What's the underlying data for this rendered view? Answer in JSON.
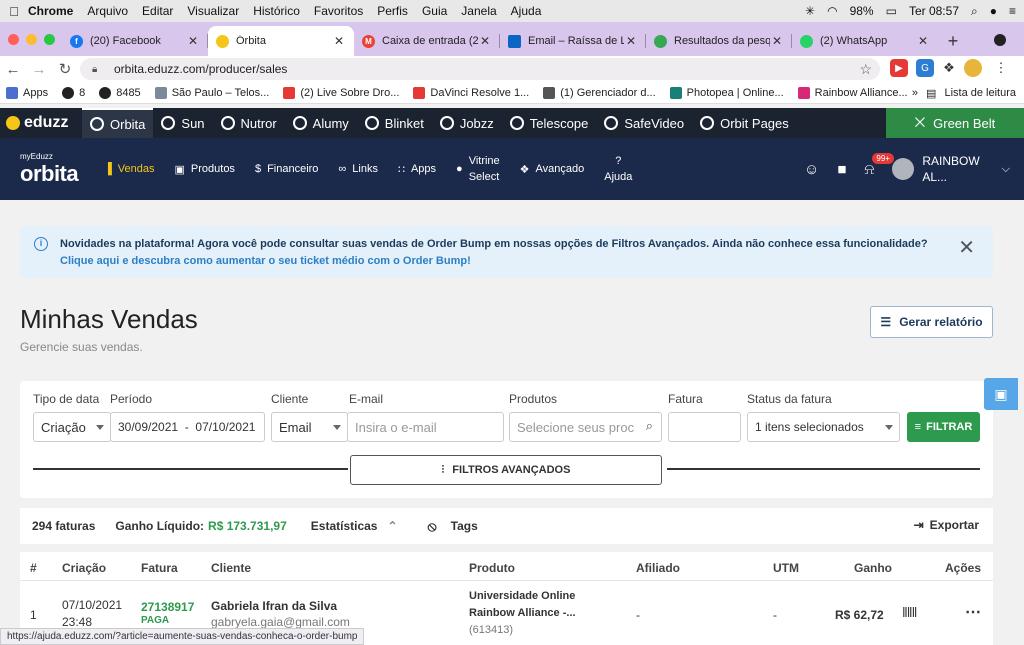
{
  "mac_menubar": {
    "app": "Chrome",
    "items": [
      "Arquivo",
      "Editar",
      "Visualizar",
      "Histórico",
      "Favoritos",
      "Perfis",
      "Guia",
      "Janela",
      "Ajuda"
    ],
    "battery": "98%",
    "clock": "Ter 08:57"
  },
  "tabs": [
    {
      "title": "(20) Facebook",
      "color": "#1877f2"
    },
    {
      "title": "Órbita",
      "color": "#f5c518"
    },
    {
      "title": "Caixa de entrada (2",
      "color": "#ea4335"
    },
    {
      "title": "Email – Raíssa de La",
      "color": "#0a66c2"
    },
    {
      "title": "Resultados da pesq",
      "color": "#34a853"
    },
    {
      "title": "(2) WhatsApp",
      "color": "#25d366"
    }
  ],
  "address": {
    "url": "orbita.eduzz.com/producer/sales"
  },
  "bookmarks": {
    "items": [
      "Apps",
      "8",
      "8485",
      "São Paulo – Telos...",
      "(2) Live Sobre Dro...",
      "DaVinci Resolve 1...",
      "(1) Gerenciador d...",
      "Photopea | Online...",
      "Rainbow Alliance..."
    ],
    "more": "»",
    "reading_list": "Lista de leitura"
  },
  "eduzz_bar": {
    "logo": "eduzz",
    "items": [
      "Orbita",
      "Sun",
      "Nutror",
      "Alumy",
      "Blinket",
      "Jobzz",
      "Telescope",
      "SafeVideo",
      "Orbit Pages"
    ],
    "green_belt": "Green Belt"
  },
  "orbita_nav": {
    "brand_small": "myEduzz",
    "brand": "orbita",
    "items": [
      "Vendas",
      "Produtos",
      "Financeiro",
      "Links",
      "Apps"
    ],
    "vitrine_line1": "Vitrine",
    "vitrine_line2": "Select",
    "avancado": "Avançado",
    "ajuda": "Ajuda",
    "notif_badge": "99+",
    "user_line1": "RAINBOW",
    "user_line2": "AL..."
  },
  "alert": {
    "text": "Novidades na plataforma! Agora você pode consultar suas vendas de Order Bump em nossas opções de Filtros Avançados. Ainda não conhece essa funcionalidade?",
    "link": "Clique aqui e descubra como aumentar o seu ticket médio com o Order Bump!"
  },
  "page": {
    "title": "Minhas Vendas",
    "subtitle": "Gerencie suas vendas.",
    "report_button": "Gerar relatório"
  },
  "filters": {
    "tipo_label": "Tipo de data",
    "tipo_value": "Criação",
    "periodo_label": "Período",
    "periodo_value": "30/09/2021  -  07/10/2021",
    "cliente_label": "Cliente",
    "cliente_value": "Email",
    "email_label": "E-mail",
    "email_placeholder": "Insira o e-mail",
    "produtos_label": "Produtos",
    "produtos_placeholder": "Selecione seus proc",
    "fatura_label": "Fatura",
    "status_label": "Status da fatura",
    "status_value": "1 itens selecionados",
    "filtrar": "FILTRAR",
    "advanced": "FILTROS AVANÇADOS"
  },
  "stats": {
    "faturas": "294 faturas",
    "ganho_label": "Ganho Líquido:",
    "ganho_value": "R$ 173.731,97",
    "estatisticas": "Estatísticas",
    "tags": "Tags",
    "exportar": "Exportar"
  },
  "table": {
    "headers": [
      "#",
      "Criação",
      "Fatura",
      "Cliente",
      "Produto",
      "Afiliado",
      "UTM",
      "Ganho",
      "Ações"
    ],
    "rows": [
      {
        "num": "1",
        "date": "07/10/2021",
        "time": "23:48",
        "fatura": "27138917",
        "status": "PAGA",
        "cliente": "Gabriela Ifran da Silva",
        "email": "gabryela.gaia@gmail.com",
        "produto_line1": "Universidade Online",
        "produto_line2": "Rainbow Alliance -...",
        "produto_id": "(613413)",
        "afiliado": "-",
        "utm": "-",
        "ganho": "R$ 62,72"
      }
    ]
  },
  "status_url": "https://ajuda.eduzz.com/?article=aumente-suas-vendas-conheca-o-order-bump"
}
